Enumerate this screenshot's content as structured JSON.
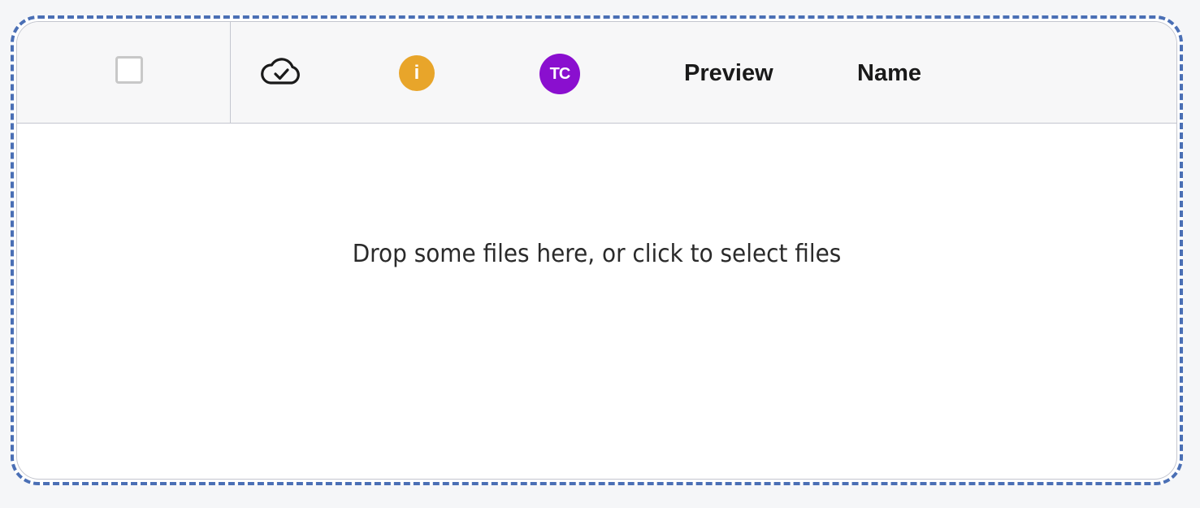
{
  "colors": {
    "dropzone_border": "#4a6fb5",
    "info_badge": "#e8a52a",
    "avatar_bg": "#8a0fcf",
    "header_bg": "#f7f7f8"
  },
  "header": {
    "select_all_icon": "checkbox-empty",
    "sync_icon": "cloud-check-icon",
    "info": {
      "icon": "info-icon",
      "glyph": "i"
    },
    "user_avatar": {
      "initials": "TC"
    },
    "columns": {
      "preview": "Preview",
      "name": "Name"
    }
  },
  "dropzone": {
    "message": "Drop some files here, or click to select files"
  }
}
